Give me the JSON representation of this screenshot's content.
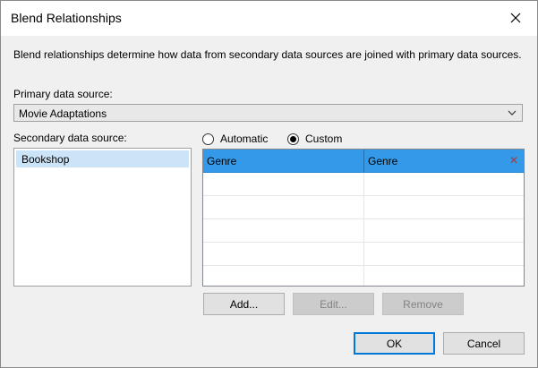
{
  "window": {
    "title": "Blend Relationships"
  },
  "description": "Blend relationships determine how data from secondary data sources are joined with primary data sources.",
  "primary": {
    "label": "Primary data source:",
    "selected": "Movie Adaptations"
  },
  "secondary": {
    "label": "Secondary data source:",
    "items": [
      {
        "label": "Bookshop",
        "selected": true
      }
    ]
  },
  "mode": {
    "automatic_label": "Automatic",
    "custom_label": "Custom",
    "selected": "custom"
  },
  "mappings": [
    {
      "primary_field": "Genre",
      "secondary_field": "Genre"
    }
  ],
  "buttons": {
    "add": "Add...",
    "edit": "Edit...",
    "remove": "Remove",
    "ok": "OK",
    "cancel": "Cancel"
  },
  "colors": {
    "selected_row": "#3399e8",
    "selected_list_item": "#cce4f7",
    "default_button_border": "#0078d7"
  },
  "icons": {
    "close": "close-icon",
    "dropdown": "chevron-down-icon",
    "row_remove": "remove-x-icon"
  }
}
